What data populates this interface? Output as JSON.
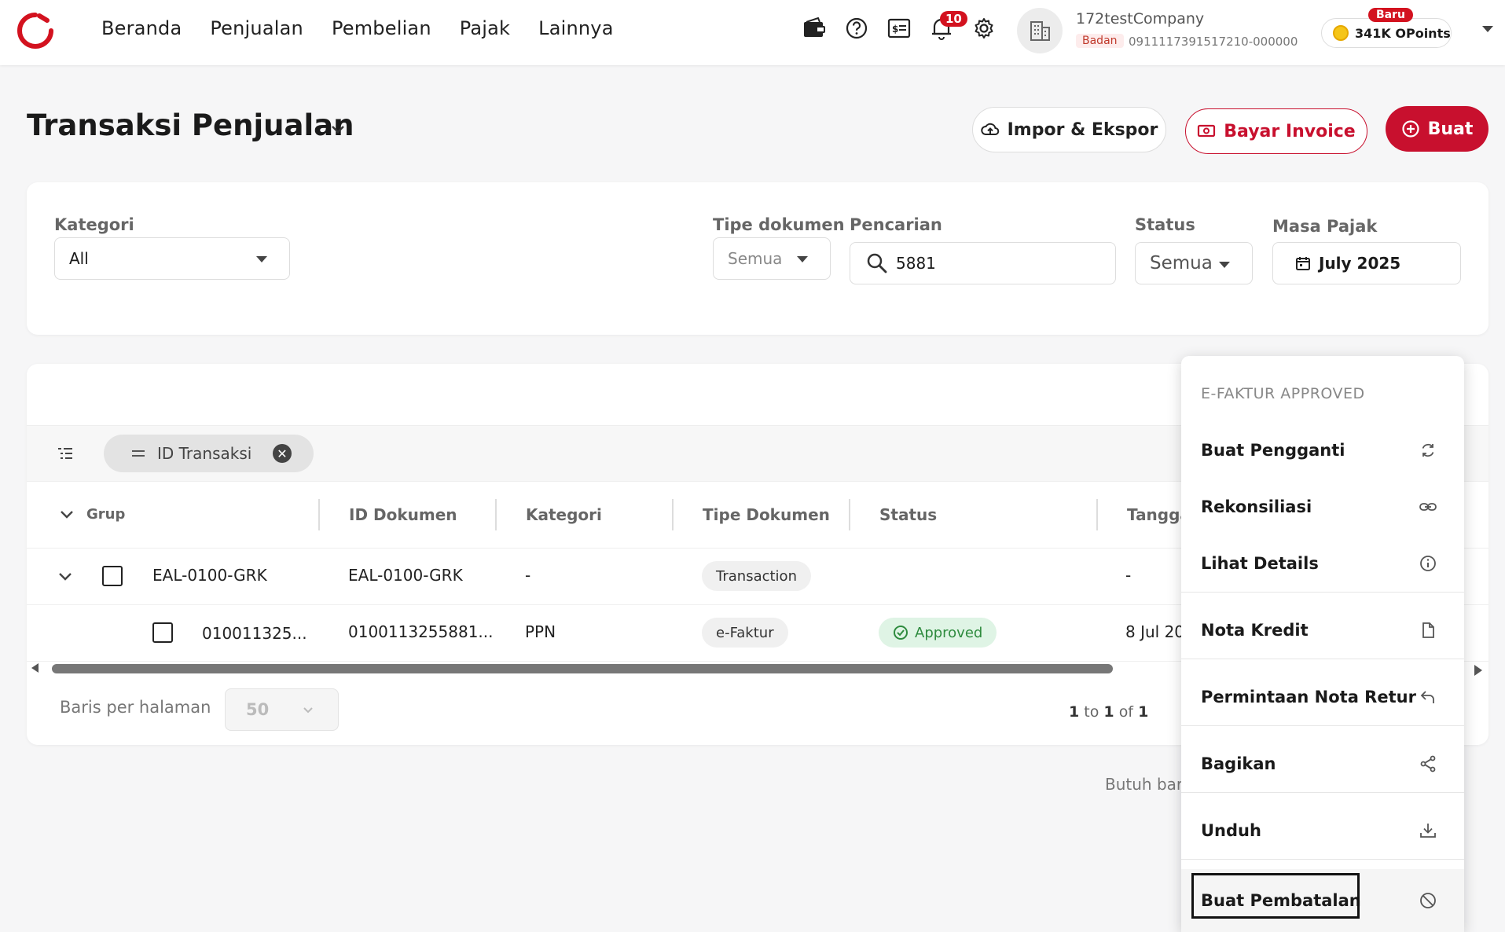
{
  "nav": {
    "items": [
      "Beranda",
      "Penjualan",
      "Pembelian",
      "Pajak",
      "Lainnya"
    ],
    "notification_count": "10"
  },
  "company": {
    "name": "172testCompany",
    "type_badge": "Badan",
    "id": "0911117391517210-000000"
  },
  "opoints": {
    "label": "341K OPoints",
    "new_badge": "Baru"
  },
  "page": {
    "title": "Transaksi Penjualan",
    "impor_label": "Impor & Ekspor",
    "bayar_label": "Bayar Invoice",
    "buat_label": "Buat"
  },
  "filters": {
    "kategori_label": "Kategori",
    "kategori_value": "All",
    "tipe_label": "Tipe dokumen",
    "tipe_value": "Semua",
    "pencarian_label": "Pencarian",
    "pencarian_value": "5881",
    "status_label": "Status",
    "status_value": "Semua",
    "masa_label": "Masa Pajak",
    "masa_value": "July 2025"
  },
  "table": {
    "chip_label": "ID Transaksi",
    "headers": {
      "grup": "Grup",
      "id_dokumen": "ID Dokumen",
      "kategori": "Kategori",
      "tipe_dokumen": "Tipe Dokumen",
      "status": "Status",
      "tanggal": "Tangga"
    },
    "group_row": {
      "grup": "EAL-0100-GRK",
      "id_dokumen": "EAL-0100-GRK",
      "kategori": "-",
      "tipe": "Transaction",
      "tanggal": "-"
    },
    "child_row": {
      "grup": "010011325...",
      "id_dokumen": "0100113255881...",
      "kategori": "PPN",
      "tipe": "e-Faktur",
      "status": "Approved",
      "tanggal": "8 Jul 20"
    },
    "rows_label": "Baris per halaman",
    "rows_value": "50",
    "pagination": {
      "from": "1",
      "to_word": "to",
      "to": "1",
      "of_word": "of",
      "total": "1"
    },
    "help_text": "Butuh bar"
  },
  "menu": {
    "header": "E-FAKTUR APPROVED",
    "items": [
      {
        "label": "Buat Pengganti",
        "icon": "refresh-icon"
      },
      {
        "label": "Rekonsiliasi",
        "icon": "link-icon"
      },
      {
        "label": "Lihat Details",
        "icon": "info-icon"
      },
      {
        "label": "Nota Kredit",
        "icon": "file-icon"
      },
      {
        "label": "Permintaan Nota Retur",
        "icon": "undo-icon"
      },
      {
        "label": "Bagikan",
        "icon": "share-icon"
      },
      {
        "label": "Unduh",
        "icon": "download-icon"
      },
      {
        "label": "Buat Pembatalan",
        "icon": "ban-icon"
      }
    ]
  },
  "colors": {
    "brand_red": "#c8102e",
    "approved_green": "#2e8b3e"
  }
}
